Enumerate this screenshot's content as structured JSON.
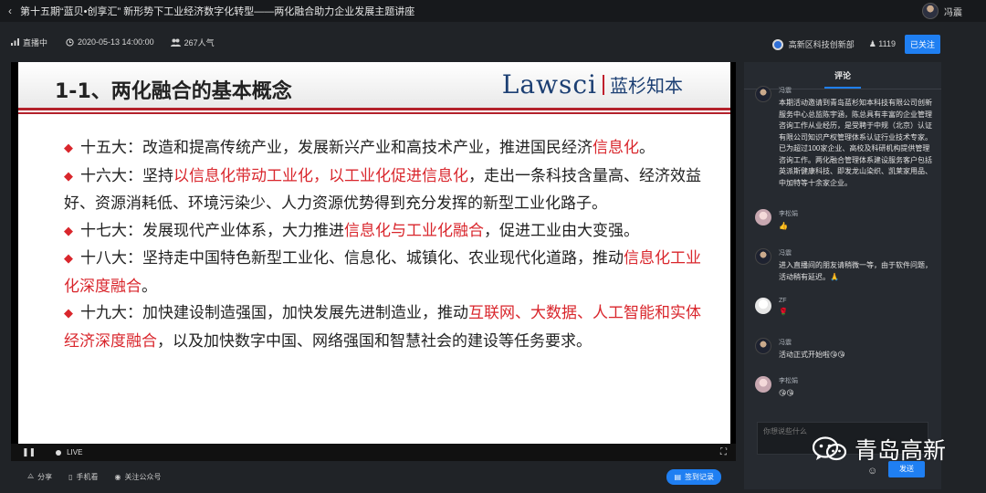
{
  "window": {
    "title": "第十五期“蓝贝•创享汇” 新形势下工业经济数字化转型——两化融合助力企业发展主题讲座",
    "user_name": "冯震"
  },
  "info": {
    "status": "直播中",
    "datetime": "2020-05-13 14:00:00",
    "popularity": "267人气",
    "org": "高新区科技创新部",
    "fans": "1119",
    "follow_label": "已关注"
  },
  "slide": {
    "title": "1-1、两化融合的基本概念",
    "logo_en": "Lawsci",
    "logo_cn": "蓝杉知本",
    "items": [
      {
        "a": "十五大：改造和提高传统产业，发展新兴产业和高技术产业，推进国民经济",
        "r": "信息化",
        "b": "。",
        "r2": "",
        "c": ""
      },
      {
        "a": "十六大：坚持",
        "r": "以信息化带动工业化，以工业化促进信息化",
        "b": "，走出一条科技含量高、经济效益好、资源消耗低、环境污染少、人力资源优势得到充分发挥的新型工业化路子。",
        "r2": "",
        "c": ""
      },
      {
        "a": "十七大：发展现代产业体系，大力推进",
        "r": "信息化与工业化融合",
        "b": "，促进工业由大变强。",
        "r2": "",
        "c": ""
      },
      {
        "a": "十八大：坚持走中国特色新型工业化、信息化、城镇化、农业现代化道路，推动",
        "r": "信息化工业化深度融合",
        "b": "。",
        "r2": "",
        "c": ""
      },
      {
        "a": "十九大：加快建设制造强国，加快发展先进制造业，推动",
        "r": "互联网、大数据、人工智能和实体经济深度融合",
        "b": "，以及加快数字中国、网络强国和智慧社会的建设等任务要求。",
        "r2": "",
        "c": ""
      }
    ]
  },
  "player": {
    "live_label": "LIVE"
  },
  "bottom": {
    "share": "分享",
    "mobile": "手机看",
    "follow_official": "关注公众号",
    "record": "签到记录"
  },
  "comments_panel": {
    "title": "评论",
    "comments": [
      {
        "name": "冯震",
        "avatar": "f",
        "text": "本期活动邀请到青岛蓝杉知本科技有限公司创新服务中心总监陈宇涵，陈总具有丰富的企业管理咨询工作从业经历，是受聘于中规（北京）认证有限公司知识产权管理体系认证行业技术专家。已为超过100家企业、高校及科研机构提供管理咨询工作。两化融合管理体系建设服务客户包括英派斯健康科技、即发龙山染织、凯莱家用品、中加特等十余家企业。"
      },
      {
        "name": "李松娟",
        "avatar": "l",
        "text": "👍"
      },
      {
        "name": "冯震",
        "avatar": "f",
        "text": "进入直播间的朋友请稍微一等，由于软件问题，活动稍有延迟。🙏"
      },
      {
        "name": "ZF",
        "avatar": "z",
        "text": "🌹"
      },
      {
        "name": "冯震",
        "avatar": "f",
        "text": "活动正式开始啦😘😘"
      },
      {
        "name": "李松娟",
        "avatar": "l",
        "text": "😘😘"
      }
    ],
    "input_placeholder": "你想说些什么",
    "send_label": "发送"
  },
  "watermark": {
    "text": "青岛高新"
  },
  "colors": {
    "accent": "#1f7ff2",
    "slide_red": "#d9262c",
    "background": "#202327"
  }
}
